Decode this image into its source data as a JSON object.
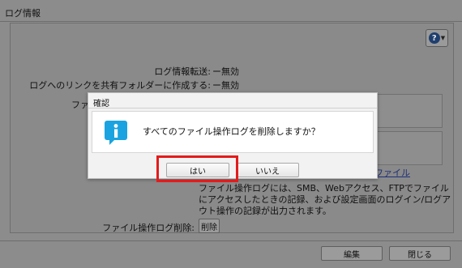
{
  "window": {
    "title": "ログ情報"
  },
  "settings": {
    "log_transfer_label": "ログ情報転送:",
    "log_transfer_value": "ー無効",
    "share_link_label": "ログへのリンクを共有フォルダーに作成する:",
    "share_link_value": "ー無効",
    "file_label_partial": "ファ",
    "file_link_partial": "ファイル",
    "description": "ファイル操作ログには、SMB、Webアクセス、FTPでファイルにアクセスしたときの記録、および設定画面のログイン/ログアウト操作の記録が出力されます。",
    "delete_label": "ファイル操作ログ削除:",
    "delete_button": "削除"
  },
  "footer": {
    "edit_button": "編集",
    "close_button": "閉じる"
  },
  "dialog": {
    "title": "確認",
    "message": "すべてのファイル操作ログを削除しますか？",
    "yes_button": "はい",
    "no_button": "いいえ",
    "icon": "info-icon",
    "icon_color": "#1aa3e0"
  },
  "highlight_color": "#e31b1b"
}
